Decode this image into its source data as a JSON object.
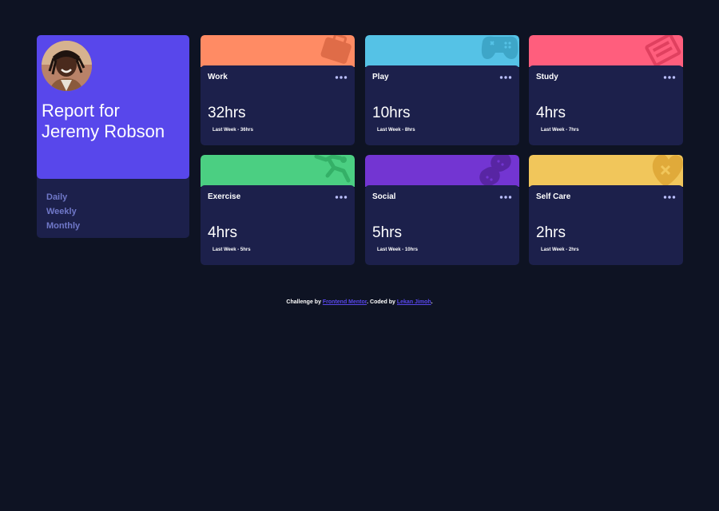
{
  "profile": {
    "report_label": "Report for",
    "name": "Jeremy Robson",
    "avatar_icon": "user-avatar-photo",
    "accent_color": "#5847eb",
    "periods": [
      "Daily",
      "Weekly",
      "Monthly"
    ]
  },
  "cards": [
    {
      "title": "Work",
      "hours": "32hrs",
      "previous": "Last Week - 36hrs",
      "color": "#ff8b64",
      "icon": "briefcase-icon"
    },
    {
      "title": "Play",
      "hours": "10hrs",
      "previous": "Last Week - 8hrs",
      "color": "#55c2e6",
      "icon": "gamepad-icon"
    },
    {
      "title": "Study",
      "hours": "4hrs",
      "previous": "Last Week - 7hrs",
      "color": "#ff5e7d",
      "icon": "books-icon"
    },
    {
      "title": "Exercise",
      "hours": "4hrs",
      "previous": "Last Week - 5hrs",
      "color": "#4bcf82",
      "icon": "running-icon"
    },
    {
      "title": "Social",
      "hours": "5hrs",
      "previous": "Last Week - 10hrs",
      "color": "#7335d2",
      "icon": "chat-bubbles-icon"
    },
    {
      "title": "Self Care",
      "hours": "2hrs",
      "previous": "Last Week - 2hrs",
      "color": "#f1c65b",
      "icon": "heart-bandage-icon"
    }
  ],
  "footer": {
    "challenge_by": "Challenge by ",
    "frontend_mentor": "Frontend Mentor",
    "coded_by": ". Coded by ",
    "author": "Lekan Jimoh",
    "end": "."
  }
}
